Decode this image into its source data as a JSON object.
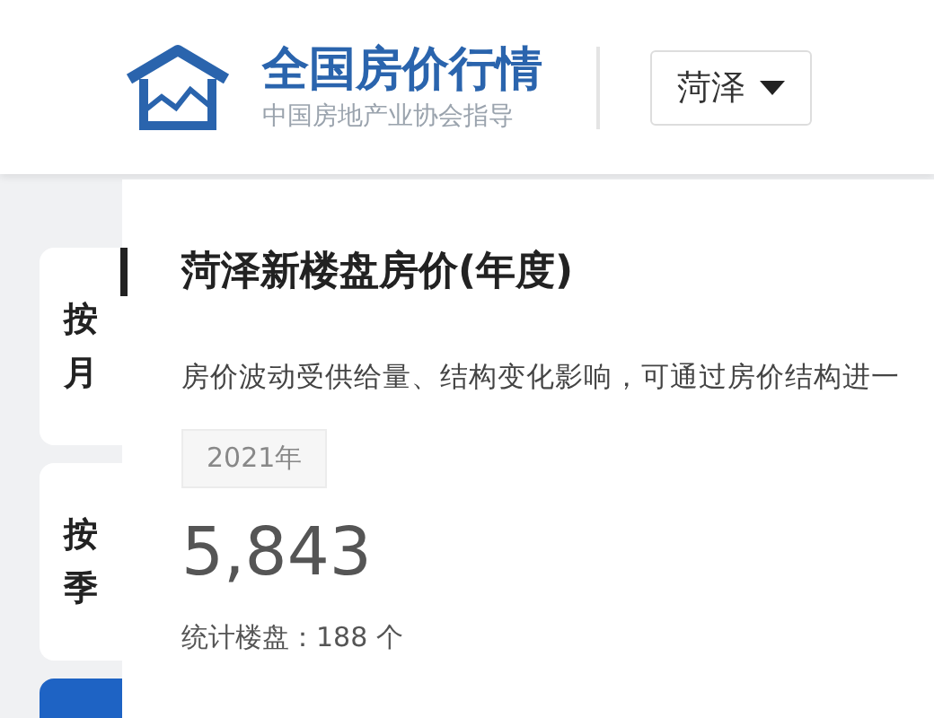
{
  "header": {
    "title": "全国房价行情",
    "subtitle": "中国房地产业协会指导",
    "city": {
      "value": "菏泽"
    }
  },
  "period_tabs": [
    {
      "label": "按月",
      "selected": false
    },
    {
      "label": "按季",
      "selected": false
    },
    {
      "selected": true
    }
  ],
  "panel": {
    "title": "菏泽新楼盘房价(年度)",
    "description": "房价波动受供给量、结构变化影响，可通过房价结构进一",
    "year": "2021年",
    "price": "5,843",
    "count_label": "统计楼盘：188 个"
  }
}
